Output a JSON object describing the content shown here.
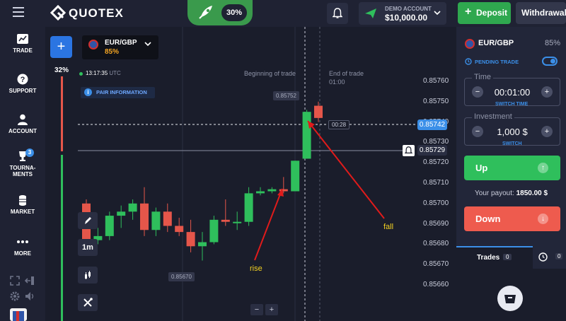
{
  "header": {
    "brand": "QUOTEX",
    "boost_percent": "30%",
    "account_label": "DEMO ACCOUNT",
    "account_balance": "$10,000.00",
    "deposit_label": "Deposit",
    "withdrawal_label": "Withdrawal"
  },
  "nav": [
    {
      "label": "TRADE",
      "icon": "chart-icon"
    },
    {
      "label": "SUPPORT",
      "icon": "help-icon"
    },
    {
      "label": "ACCOUNT",
      "icon": "user-icon"
    },
    {
      "label": "TOURNA-",
      "label2": "MENTS",
      "icon": "trophy-icon",
      "badge": "3"
    },
    {
      "label": "MARKET",
      "icon": "coins-icon"
    },
    {
      "label": "MORE",
      "icon": "more-icon"
    }
  ],
  "asset": {
    "name": "EUR/GBP",
    "payout": "85%"
  },
  "chart": {
    "time": "13:17:35",
    "tz": "UTC",
    "pair_info": "PAIR INFORMATION",
    "timeframe": "1m",
    "sentiment_pct": "32%",
    "beginning_label": "Beginning of trade",
    "end_label": "End of trade",
    "end_time": "01:00",
    "countdown": "00:28",
    "high_marker": "0.85752",
    "low_marker": "0.85670",
    "current_price": "0.85742",
    "strike_price": "0.85729",
    "price_axis": [
      "0.85760",
      "0.85750",
      "0.85740",
      "0.85730",
      "0.85720",
      "0.85710",
      "0.85700",
      "0.85690",
      "0.85680",
      "0.85670",
      "0.85660"
    ],
    "annot_rise": "rise",
    "annot_fall": "fall",
    "colors": {
      "up": "#2fbf5c",
      "down": "#e5564a",
      "accent": "#3b8fe8",
      "annot": "#f2d022",
      "arrow": "#e01b1b"
    }
  },
  "chart_data": {
    "type": "candlestick",
    "ylim": [
      0.85655,
      0.85765
    ],
    "candles": [
      {
        "o": 0.857,
        "h": 0.85702,
        "l": 0.8568,
        "c": 0.85682
      },
      {
        "o": 0.85682,
        "h": 0.85688,
        "l": 0.8568,
        "c": 0.85684
      },
      {
        "o": 0.85684,
        "h": 0.85696,
        "l": 0.85682,
        "c": 0.85694
      },
      {
        "o": 0.85694,
        "h": 0.85699,
        "l": 0.85688,
        "c": 0.85696
      },
      {
        "o": 0.85696,
        "h": 0.85702,
        "l": 0.85692,
        "c": 0.857
      },
      {
        "o": 0.857,
        "h": 0.85708,
        "l": 0.85684,
        "c": 0.85687
      },
      {
        "o": 0.85687,
        "h": 0.85698,
        "l": 0.85684,
        "c": 0.85696
      },
      {
        "o": 0.85696,
        "h": 0.857,
        "l": 0.85686,
        "c": 0.85689
      },
      {
        "o": 0.85689,
        "h": 0.85693,
        "l": 0.85684,
        "c": 0.85686
      },
      {
        "o": 0.85686,
        "h": 0.85692,
        "l": 0.85676,
        "c": 0.85679
      },
      {
        "o": 0.85679,
        "h": 0.85686,
        "l": 0.85672,
        "c": 0.85681
      },
      {
        "o": 0.85681,
        "h": 0.85694,
        "l": 0.8568,
        "c": 0.85692
      },
      {
        "o": 0.85692,
        "h": 0.85702,
        "l": 0.85689,
        "c": 0.85691
      },
      {
        "o": 0.85691,
        "h": 0.85696,
        "l": 0.85687,
        "c": 0.85691
      },
      {
        "o": 0.85691,
        "h": 0.85708,
        "l": 0.85689,
        "c": 0.85705
      },
      {
        "o": 0.85705,
        "h": 0.85708,
        "l": 0.85704,
        "c": 0.85706
      },
      {
        "o": 0.85706,
        "h": 0.85708,
        "l": 0.85705,
        "c": 0.85707
      },
      {
        "o": 0.85707,
        "h": 0.85713,
        "l": 0.85705,
        "c": 0.85706
      },
      {
        "o": 0.85706,
        "h": 0.85721,
        "l": 0.85706,
        "c": 0.85721
      },
      {
        "o": 0.85722,
        "h": 0.85746,
        "l": 0.85722,
        "c": 0.85745
      },
      {
        "o": 0.85748,
        "h": 0.8575,
        "l": 0.8574,
        "c": 0.85742
      }
    ]
  },
  "panel": {
    "asset": "EUR/GBP",
    "payout": "85%",
    "pending_label": "PENDING TRADE",
    "time_label": "Time",
    "time_value": "00:01:00",
    "switch_time": "SWITCH TIME",
    "investment_label": "Investment",
    "investment_value": "1,000 $",
    "switch": "SWITCH",
    "up_label": "Up",
    "payout_label": "Your payout:",
    "payout_value": "1850.00 $",
    "down_label": "Down",
    "trades_label": "Trades",
    "trades_count": "0",
    "history_count": "0"
  }
}
